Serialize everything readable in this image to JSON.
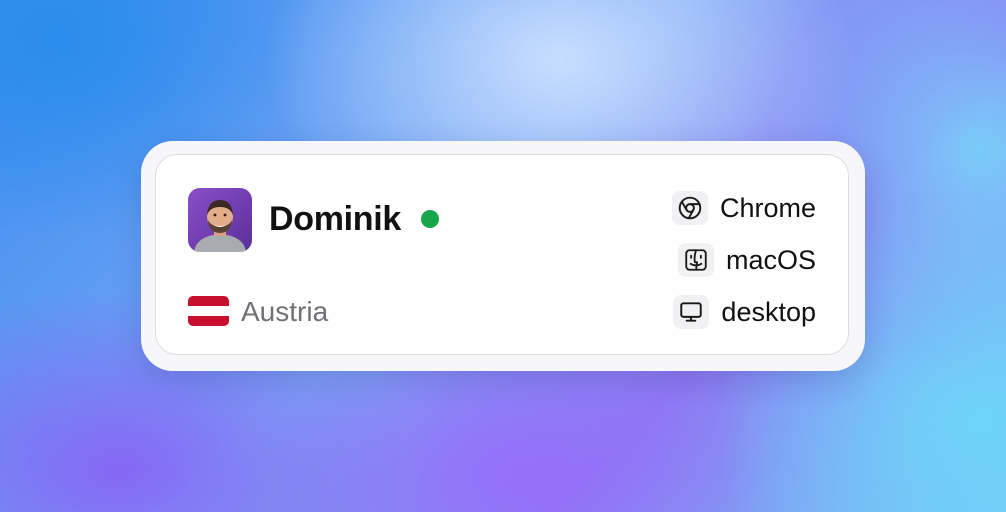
{
  "user": {
    "name": "Dominik",
    "status": "online",
    "status_color": "#17a64a",
    "avatar": "avatar-photo"
  },
  "location": {
    "country": "Austria",
    "flag": "austria-flag",
    "flag_colors": [
      "#c8102e",
      "#ffffff",
      "#c8102e"
    ]
  },
  "details": {
    "browser": {
      "label": "Chrome",
      "icon": "chrome-icon"
    },
    "os": {
      "label": "macOS",
      "icon": "finder-icon"
    },
    "device": {
      "label": "desktop",
      "icon": "monitor-icon"
    }
  }
}
